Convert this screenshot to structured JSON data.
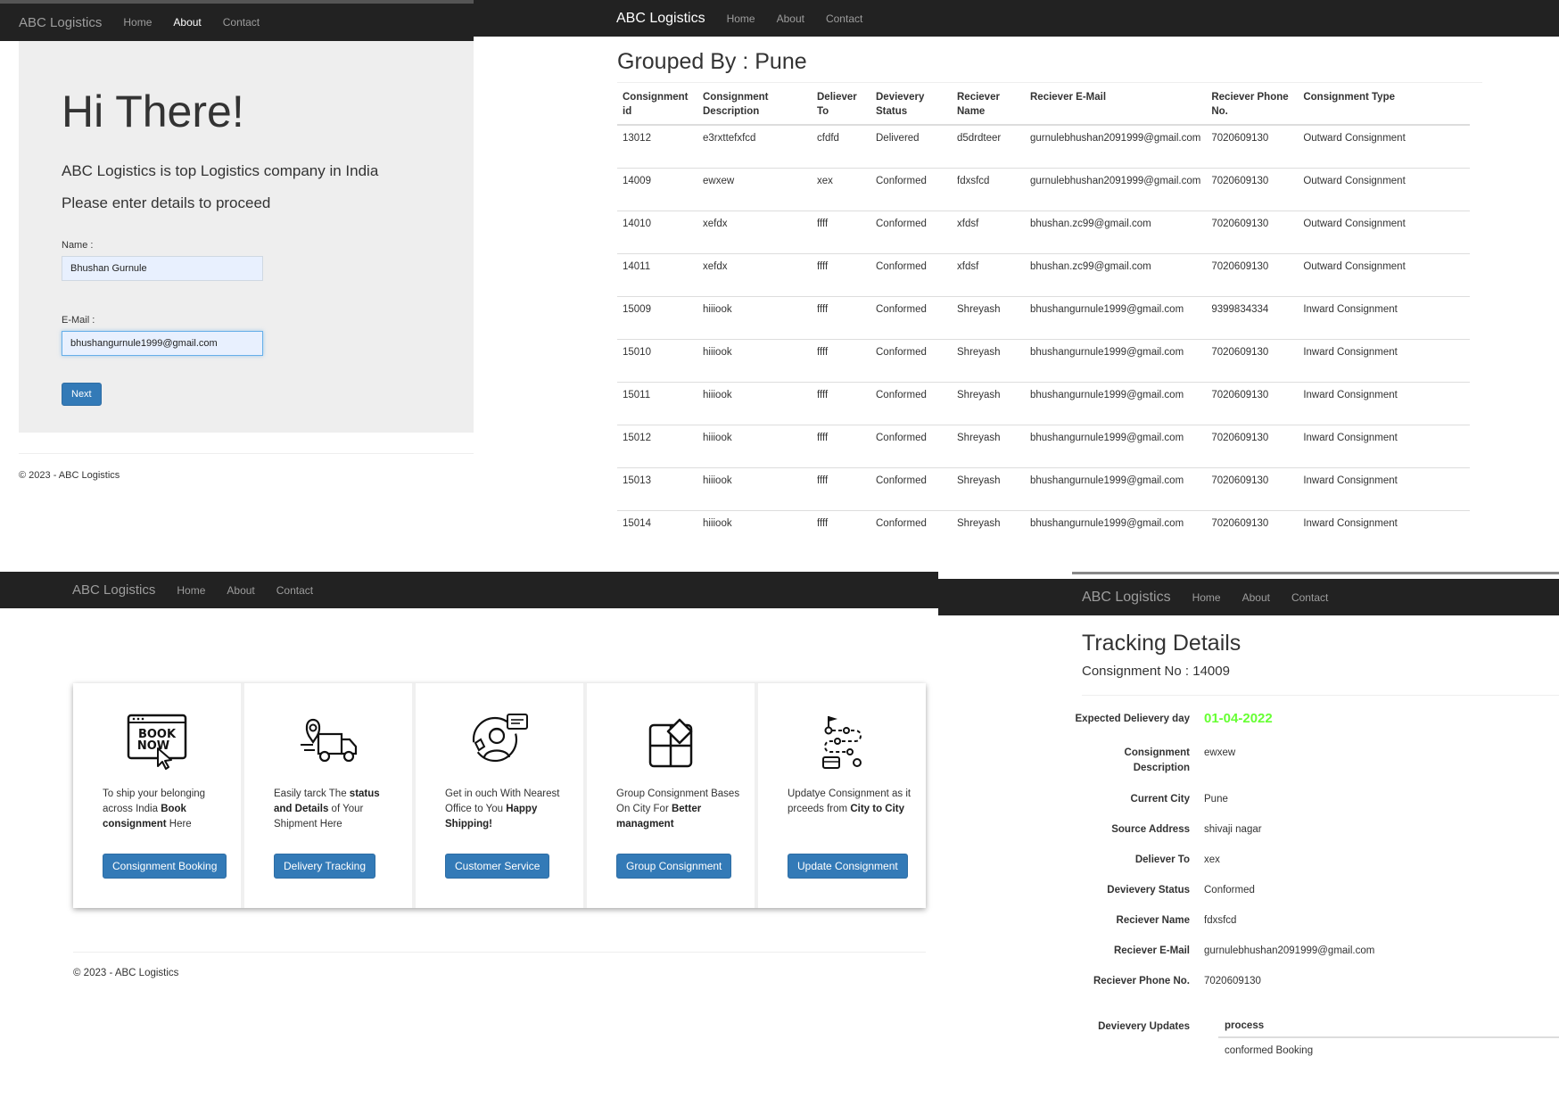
{
  "nav": {
    "brand": "ABC Logistics",
    "home": "Home",
    "about": "About",
    "contact": "Contact"
  },
  "footer": "© 2023 - ABC Logistics",
  "login": {
    "heading": "Hi There!",
    "lead1": "ABC Logistics is top Logistics company in India",
    "lead2": "Please enter details to proceed",
    "name_label": "Name :",
    "name_value": "Bhushan Gurnule",
    "email_label": "E-Mail :",
    "email_value": "bhushangurnule1999@gmail.com",
    "next_button": "Next"
  },
  "grouped": {
    "title": "Grouped By : Pune",
    "columns": [
      "Consignment id",
      "Consignment Description",
      "Deliever To",
      "Devievery Status",
      "Reciever Name",
      "Reciever E-Mail",
      "Reciever Phone No.",
      "Consignment Type"
    ],
    "rows": [
      [
        "13012",
        "e3rxttefxfcd",
        "cfdfd",
        "Delivered",
        "d5drdteer",
        "gurnulebhushan2091999@gmail.com",
        "7020609130",
        "Outward Consignment"
      ],
      [
        "14009",
        "ewxew",
        "xex",
        "Conformed",
        "fdxsfcd",
        "gurnulebhushan2091999@gmail.com",
        "7020609130",
        "Outward Consignment"
      ],
      [
        "14010",
        "xefdx",
        "ffff",
        "Conformed",
        "xfdsf",
        "bhushan.zc99@gmail.com",
        "7020609130",
        "Outward Consignment"
      ],
      [
        "14011",
        "xefdx",
        "ffff",
        "Conformed",
        "xfdsf",
        "bhushan.zc99@gmail.com",
        "7020609130",
        "Outward Consignment"
      ],
      [
        "15009",
        "hiiiook",
        "ffff",
        "Conformed",
        "Shreyash",
        "bhushangurnule1999@gmail.com",
        "9399834334",
        "Inward Consignment"
      ],
      [
        "15010",
        "hiiiook",
        "ffff",
        "Conformed",
        "Shreyash",
        "bhushangurnule1999@gmail.com",
        "7020609130",
        "Inward Consignment"
      ],
      [
        "15011",
        "hiiiook",
        "ffff",
        "Conformed",
        "Shreyash",
        "bhushangurnule1999@gmail.com",
        "7020609130",
        "Inward Consignment"
      ],
      [
        "15012",
        "hiiiook",
        "ffff",
        "Conformed",
        "Shreyash",
        "bhushangurnule1999@gmail.com",
        "7020609130",
        "Inward Consignment"
      ],
      [
        "15013",
        "hiiiook",
        "ffff",
        "Conformed",
        "Shreyash",
        "bhushangurnule1999@gmail.com",
        "7020609130",
        "Inward Consignment"
      ],
      [
        "15014",
        "hiiiook",
        "ffff",
        "Conformed",
        "Shreyash",
        "bhushangurnule1999@gmail.com",
        "7020609130",
        "Inward Consignment"
      ]
    ]
  },
  "services": {
    "cards": [
      {
        "icon": "book-now-icon",
        "icon_text1": "BOOK",
        "icon_text2": "NOW",
        "pre": "To ship your belonging across India ",
        "bold": "Book consignment",
        "post": " Here",
        "button": "Consignment Booking"
      },
      {
        "icon": "delivery-truck-icon",
        "pre": "Easily tarck The ",
        "bold": "status and Details",
        "post": " of Your Shipment Here",
        "button": "Delivery Tracking"
      },
      {
        "icon": "customer-service-icon",
        "pre": "Get in ouch With Nearest Office to You ",
        "bold": "Happy Shipping!",
        "post": "",
        "button": "Customer Service"
      },
      {
        "icon": "group-blocks-icon",
        "pre": "Group Consignment Bases On City For ",
        "bold": "Better managment",
        "post": "",
        "button": "Group Consignment"
      },
      {
        "icon": "route-update-icon",
        "pre": "Updatye Consignment as it prceeds from ",
        "bold": "City to City",
        "post": "",
        "button": "Update Consignment"
      }
    ]
  },
  "tracking": {
    "title": "Tracking Details",
    "subtitle": "Consignment No : 14009",
    "accent_color": "#66ff33",
    "fields": [
      {
        "label": "Expected Delievery day",
        "value": "01-04-2022"
      },
      {
        "label": "Consignment Description",
        "value": "ewxew"
      },
      {
        "label": "Current City",
        "value": "Pune"
      },
      {
        "label": "Source Address",
        "value": "shivaji nagar"
      },
      {
        "label": "Deliever To",
        "value": "xex"
      },
      {
        "label": "Devievery Status",
        "value": "Conformed"
      },
      {
        "label": "Reciever Name",
        "value": "fdxsfcd"
      },
      {
        "label": "Reciever E-Mail",
        "value": "gurnulebhushan2091999@gmail.com"
      },
      {
        "label": "Reciever Phone No.",
        "value": "7020609130"
      }
    ],
    "updates_label": "Devievery Updates",
    "updates_header": "process",
    "updates_row": "conformed Booking"
  }
}
